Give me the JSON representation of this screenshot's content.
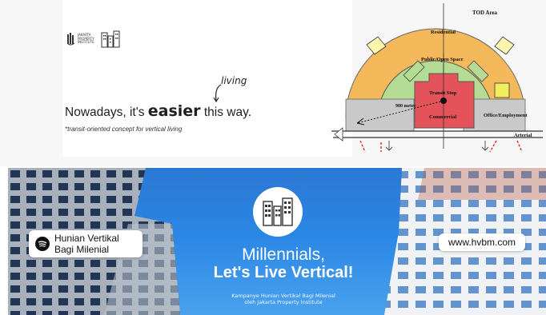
{
  "slide": {
    "logo_text": [
      "JAKARTA",
      "PROPERTY",
      "INSTITUTE"
    ],
    "headline_before": "Nowadays, it's ",
    "headline_bold": "easier",
    "headline_after": " this way.",
    "annotation": "living",
    "subcaption": "*transit-oriented concept for vertical living"
  },
  "tod_diagram": {
    "label_area": "TOD Area",
    "label_residential": "Residential",
    "label_public": "Public/Open Space",
    "label_transit": "Transit Stop",
    "label_900": "900 meter",
    "label_commercial": "Commercial",
    "label_office": "Office/Employment",
    "label_arterial": "Arterial",
    "colors": {
      "residential": "#f3b95a",
      "public": "#b5dc95",
      "commercial": "#e4525a",
      "office": "#c9c9c9",
      "transit_marker": "#111111",
      "arrow": "#d62c2c"
    }
  },
  "banner": {
    "spotify_line1": "Hunian Vertikal",
    "spotify_line2": "Bagi Milenial",
    "website": "www.hvbm.com",
    "title": "Millennials,",
    "subtitle": "Let's Live Vertical!",
    "campaign_line1": "Kampanye Hunian Vertikal Bagi Milenial",
    "campaign_line2": "oleh Jakarta Property Institute",
    "sky_color": "#2a86e4"
  }
}
